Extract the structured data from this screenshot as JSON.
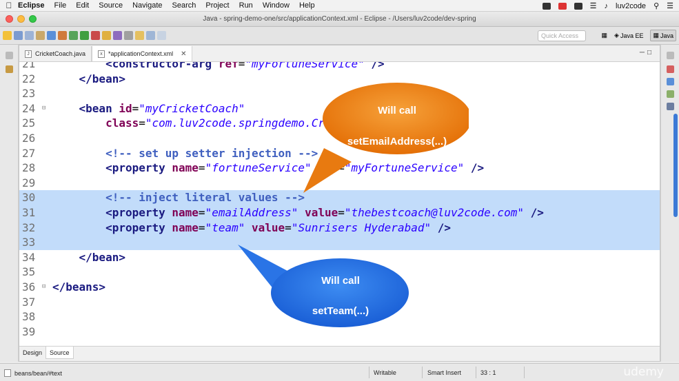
{
  "menubar": {
    "app": "Eclipse",
    "items": [
      "File",
      "Edit",
      "Source",
      "Navigate",
      "Search",
      "Project",
      "Run",
      "Window",
      "Help"
    ],
    "user": "luv2code"
  },
  "window": {
    "title": "Java - spring-demo-one/src/applicationContext.xml - Eclipse - /Users/luv2code/dev-spring"
  },
  "toolbar": {
    "quick_access_placeholder": "Quick Access",
    "perspectives": [
      "Java EE",
      "Java"
    ]
  },
  "editor": {
    "tabs": [
      {
        "label": "CricketCoach.java",
        "icon": "java-file-icon"
      },
      {
        "label": "*applicationContext.xml",
        "icon": "xml-file-icon",
        "close": "✕"
      }
    ],
    "bottom_tabs": [
      "Design",
      "Source"
    ],
    "lines": [
      {
        "num": "21",
        "parts": [
          [
            "plain",
            "        "
          ],
          [
            "tag",
            "<constructor-arg "
          ],
          [
            "attr",
            "ref"
          ],
          [
            "plain",
            "="
          ],
          [
            "val",
            "\"myFortuneService\""
          ],
          [
            "tag",
            " />"
          ]
        ]
      },
      {
        "num": "22",
        "parts": [
          [
            "plain",
            "    "
          ],
          [
            "tag",
            "</bean>"
          ]
        ]
      },
      {
        "num": "23",
        "parts": []
      },
      {
        "num": "24",
        "fold": true,
        "parts": [
          [
            "plain",
            "    "
          ],
          [
            "tag",
            "<bean "
          ],
          [
            "attr",
            "id"
          ],
          [
            "plain",
            "="
          ],
          [
            "val",
            "\"myCricketCoach\""
          ]
        ]
      },
      {
        "num": "25",
        "parts": [
          [
            "plain",
            "        "
          ],
          [
            "attr",
            "class"
          ],
          [
            "plain",
            "="
          ],
          [
            "val",
            "\"com.luv2code.springdemo.CricketCoach\""
          ],
          [
            "tag",
            ">"
          ]
        ]
      },
      {
        "num": "26",
        "parts": []
      },
      {
        "num": "27",
        "parts": [
          [
            "plain",
            "        "
          ],
          [
            "com",
            "<!-- set up setter injection -->"
          ]
        ]
      },
      {
        "num": "28",
        "parts": [
          [
            "plain",
            "        "
          ],
          [
            "tag",
            "<property "
          ],
          [
            "attr",
            "name"
          ],
          [
            "plain",
            "="
          ],
          [
            "val",
            "\"fortuneService\""
          ],
          [
            "plain",
            " "
          ],
          [
            "attr",
            "ref"
          ],
          [
            "plain",
            "="
          ],
          [
            "val",
            "\"myFortuneService\""
          ],
          [
            "tag",
            " />"
          ]
        ]
      },
      {
        "num": "29",
        "parts": []
      },
      {
        "num": "30",
        "hl": true,
        "parts": [
          [
            "plain",
            "        "
          ],
          [
            "com",
            "<!-- inject literal values -->"
          ]
        ]
      },
      {
        "num": "31",
        "hl": true,
        "parts": [
          [
            "plain",
            "        "
          ],
          [
            "tag",
            "<property "
          ],
          [
            "attr",
            "name"
          ],
          [
            "plain",
            "="
          ],
          [
            "val",
            "\"emailAddress\""
          ],
          [
            "plain",
            " "
          ],
          [
            "attr",
            "value"
          ],
          [
            "plain",
            "="
          ],
          [
            "val",
            "\"thebestcoach@luv2code.com\""
          ],
          [
            "tag",
            " />"
          ]
        ]
      },
      {
        "num": "32",
        "hl": true,
        "parts": [
          [
            "plain",
            "        "
          ],
          [
            "tag",
            "<property "
          ],
          [
            "attr",
            "name"
          ],
          [
            "plain",
            "="
          ],
          [
            "val",
            "\"team\""
          ],
          [
            "plain",
            " "
          ],
          [
            "attr",
            "value"
          ],
          [
            "plain",
            "="
          ],
          [
            "val",
            "\"Sunrisers Hyderabad\""
          ],
          [
            "tag",
            " />"
          ]
        ]
      },
      {
        "num": "33",
        "hl": true,
        "parts": []
      },
      {
        "num": "34",
        "parts": [
          [
            "plain",
            "    "
          ],
          [
            "tag",
            "</bean>"
          ]
        ]
      },
      {
        "num": "35",
        "parts": []
      },
      {
        "num": "36",
        "fold": true,
        "parts": [
          [
            "tag",
            "</beans>"
          ]
        ]
      },
      {
        "num": "37",
        "parts": []
      },
      {
        "num": "38",
        "parts": []
      },
      {
        "num": "39",
        "parts": []
      }
    ]
  },
  "callouts": {
    "orange": {
      "line1": "Will call",
      "line2": "setEmailAddress(...)",
      "color": "#ef7d10"
    },
    "blue": {
      "line1": "Will call",
      "line2": "setTeam(...)",
      "color": "#1f6fe6"
    }
  },
  "statusbar": {
    "path": "beans/bean/#text",
    "writable": "Writable",
    "insert_mode": "Smart Insert",
    "position": "33 : 1",
    "watermark": "udemy"
  }
}
